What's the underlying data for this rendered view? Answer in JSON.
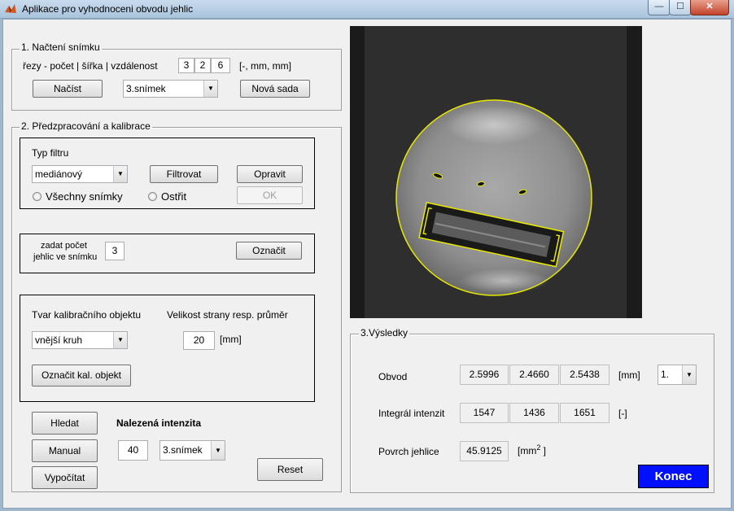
{
  "window": {
    "title": "Aplikace pro vyhodnoceni obvodu jehlic",
    "min_glyph": "—",
    "max_glyph": "☐",
    "close_glyph": "✕"
  },
  "section1": {
    "title": "1. Načtení snímku",
    "params_label": "řezy - počet | šířka | vzdálenost",
    "params_values": [
      "3",
      "2",
      "6"
    ],
    "params_units": "[-, mm, mm]",
    "load_button": "Načíst",
    "image_select": "3.snímek",
    "new_set_button": "Nová sada"
  },
  "section2": {
    "title": "2. Předzpracování a kalibrace",
    "filter_type_label": "Typ filtru",
    "filter_select": "mediánový",
    "filter_button": "Filtrovat",
    "fix_button": "Opravit",
    "all_images_radio": "Všechny snímky",
    "sharpen_radio": "Ostřit",
    "ok_button": "OK",
    "needle_count_label_1": "zadat počet",
    "needle_count_label_2": "jehlic ve snímku",
    "needle_count_value": "3",
    "mark_button": "Označit",
    "calib_shape_label": "Tvar kalibračního objektu",
    "side_size_label": "Velikost strany resp. průměr",
    "calib_shape_select": "vnější kruh",
    "side_size_value": "20",
    "side_size_unit": "[mm]",
    "mark_calib_button": "Označit kal. objekt",
    "find_button": "Hledat",
    "found_intensity_label": "Nalezená intenzita",
    "manual_button": "Manual",
    "intensity_value": "40",
    "intensity_image_select": "3.snímek",
    "compute_button": "Vypočítat",
    "reset_button": "Reset"
  },
  "section3": {
    "title": "3.Výsledky",
    "perimeter_label": "Obvod",
    "perimeter_values": [
      "2.5996",
      "2.4660",
      "2.5438"
    ],
    "perimeter_unit": "[mm]",
    "needle_select": "1.",
    "integral_label": "Integrál intenzit",
    "integral_values": [
      "1547",
      "1436",
      "1651"
    ],
    "integral_unit": "[-]",
    "surface_label": "Povrch jehlice",
    "surface_value": "45.9125",
    "surface_unit": "[mm",
    "surface_unit_sup": "2",
    "surface_unit_close": " ]"
  },
  "exit_button": "Konec",
  "colors": {
    "outline": "#e8e800",
    "konec_bg": "#0010ff"
  }
}
